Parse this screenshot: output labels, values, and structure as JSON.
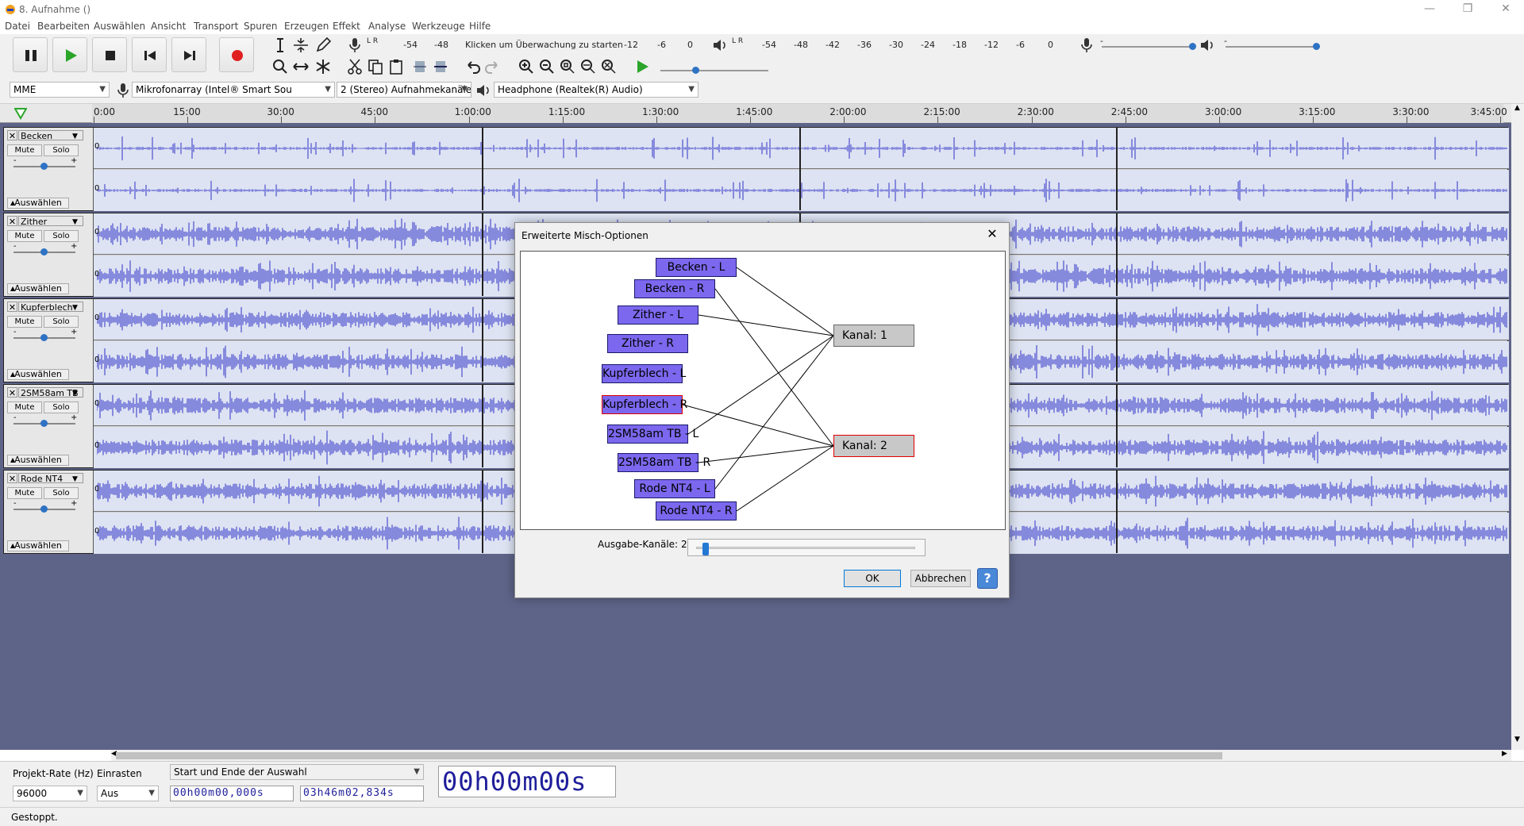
{
  "window": {
    "title": "8. Aufnahme ()"
  },
  "menu": [
    {
      "label": "Datei"
    },
    {
      "label": "Bearbeiten"
    },
    {
      "label": "Auswählen"
    },
    {
      "label": "Ansicht"
    },
    {
      "label": "Transport"
    },
    {
      "label": "Spuren"
    },
    {
      "label": "Erzeugen"
    },
    {
      "label": "Effekt"
    },
    {
      "label": "Analyse"
    },
    {
      "label": "Werkzeuge"
    },
    {
      "label": "Hilfe"
    }
  ],
  "meters": {
    "record_ticks": [
      "-54",
      "-48",
      "-12",
      "-6",
      "0"
    ],
    "record_prompt": "Klicken um Überwachung zu starten",
    "play_ticks": [
      "-54",
      "-48",
      "-42",
      "-36",
      "-30",
      "-24",
      "-18",
      "-12",
      "-6",
      "0"
    ],
    "lr": "L R",
    "slider_minus": "-",
    "slider_plus": "+"
  },
  "device_bar": {
    "host": "MME",
    "input": "Mikrofonarray (Intel® Smart Sou",
    "channels": "2 (Stereo) Aufnahmekanäle",
    "output": "Headphone (Realtek(R) Audio)"
  },
  "ruler": {
    "ticks": [
      "0:00",
      "15:00",
      "30:00",
      "45:00",
      "1:00:00",
      "1:15:00",
      "1:30:00",
      "1:45:00",
      "2:00:00",
      "2:15:00",
      "2:30:00",
      "2:45:00",
      "3:00:00",
      "3:15:00",
      "3:30:00",
      "3:45:00"
    ]
  },
  "tracks": [
    {
      "name": "Becken",
      "mute": "Mute",
      "solo": "Solo",
      "select": "Auswählen",
      "zero": "0"
    },
    {
      "name": "Zither",
      "mute": "Mute",
      "solo": "Solo",
      "select": "Auswählen",
      "zero": "0"
    },
    {
      "name": "Kupferblech",
      "mute": "Mute",
      "solo": "Solo",
      "select": "Auswählen",
      "zero": "0"
    },
    {
      "name": "2SM58am TB",
      "mute": "Mute",
      "solo": "Solo",
      "select": "Auswählen",
      "zero": "0"
    },
    {
      "name": "Rode NT4",
      "mute": "Mute",
      "solo": "Solo",
      "select": "Auswählen",
      "zero": "0"
    }
  ],
  "dialog": {
    "title": "Erweiterte Misch-Optionen",
    "close": "✕",
    "sources": [
      {
        "label": "Becken - L"
      },
      {
        "label": "Becken - R"
      },
      {
        "label": "Zither - L"
      },
      {
        "label": "Zither - R"
      },
      {
        "label": "Kupferblech - L"
      },
      {
        "label": "Kupferblech - R"
      },
      {
        "label": "2SM58am TB - L"
      },
      {
        "label": "2SM58am TB - R"
      },
      {
        "label": "Rode NT4 - L"
      },
      {
        "label": "Rode NT4 - R"
      }
    ],
    "destinations": [
      {
        "label": "Kanal:  1"
      },
      {
        "label": "Kanal:  2"
      }
    ],
    "connections": [
      [
        0,
        0
      ],
      [
        1,
        1
      ],
      [
        2,
        0
      ],
      [
        5,
        1
      ],
      [
        6,
        0
      ],
      [
        7,
        1
      ],
      [
        8,
        0
      ],
      [
        9,
        1
      ]
    ],
    "selected_source": 5,
    "selected_destination": 1,
    "output_label": "Ausgabe-Kanäle:",
    "output_value": "2",
    "output_fraction": 0.03,
    "ok": "OK",
    "cancel": "Abbrechen",
    "help": "?"
  },
  "bottom": {
    "rate_label": "Projekt-Rate (Hz)",
    "rate_value": "96000",
    "snap_label": "Einrasten",
    "snap_value": "Aus",
    "selection_mode": "Start und Ende der Auswahl",
    "sel_start": "00h00m00,000s",
    "sel_end": "03h46m02,834s",
    "position": "00h00m00s"
  },
  "status": {
    "text": "Gestoppt."
  },
  "colors": {
    "accent": "#2e72c4",
    "record": "#e02020",
    "play": "#2aa52a",
    "wave": "#3030c8",
    "source_box": "#7b68ee",
    "selected_border": "#e00000"
  }
}
